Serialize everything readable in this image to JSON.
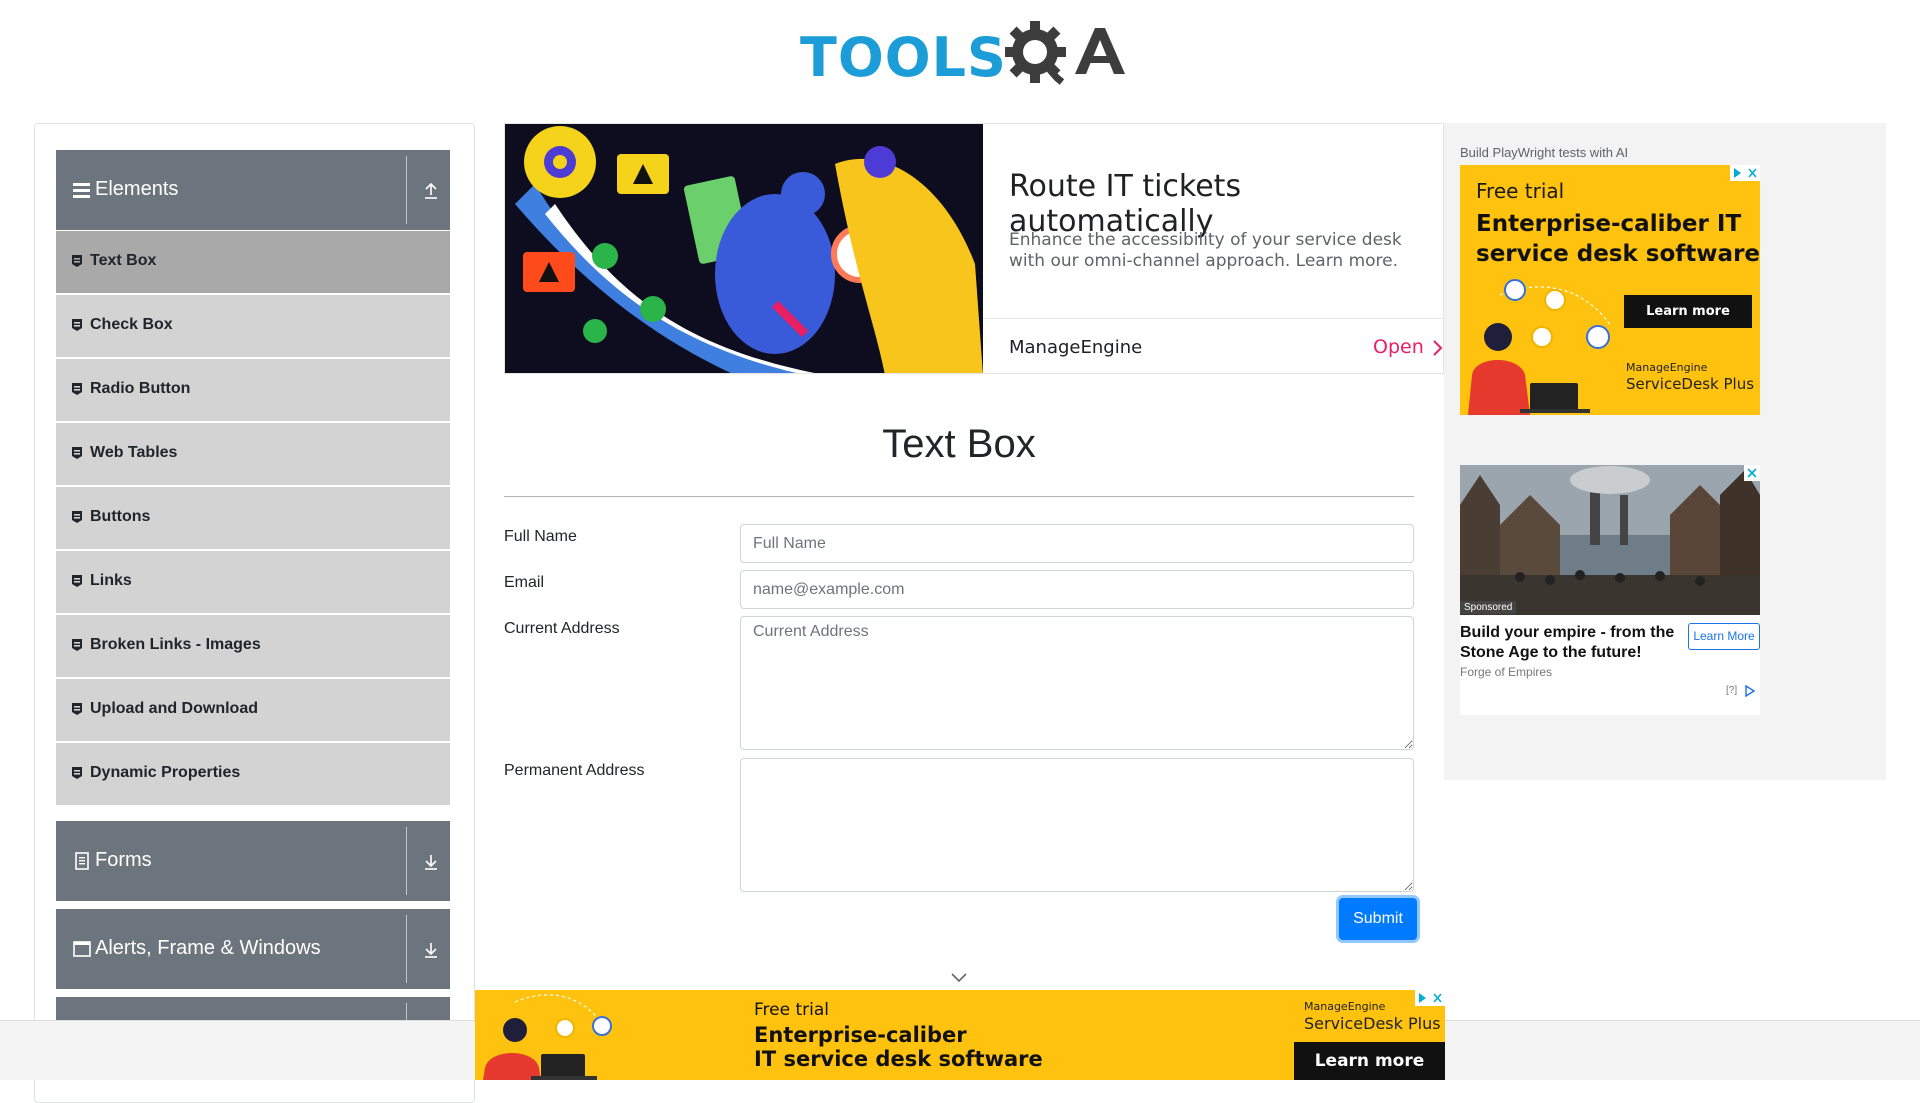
{
  "header": {
    "logo_text": "TOOLS",
    "logo_suffix": "QA"
  },
  "sidebar": {
    "groups": [
      {
        "label": "Elements",
        "icon": "hamburger-icon",
        "state": "expanded"
      },
      {
        "label": "Forms",
        "icon": "document-icon",
        "state": "collapsed"
      },
      {
        "label": "Alerts, Frame & Windows",
        "icon": "window-icon",
        "state": "collapsed"
      }
    ],
    "items": [
      {
        "label": "Text Box",
        "active": true
      },
      {
        "label": "Check Box"
      },
      {
        "label": "Radio Button"
      },
      {
        "label": "Web Tables"
      },
      {
        "label": "Buttons"
      },
      {
        "label": "Links"
      },
      {
        "label": "Broken Links - Images"
      },
      {
        "label": "Upload and Download"
      },
      {
        "label": "Dynamic Properties"
      }
    ]
  },
  "banner": {
    "title": "Route IT tickets automatically",
    "description": "Enhance the accessibility of your service desk with our omni-channel approach. Learn more.",
    "brand": "ManageEngine",
    "cta": "Open"
  },
  "main": {
    "title": "Text Box",
    "fields": {
      "full_name": {
        "label": "Full Name",
        "placeholder": "Full Name",
        "value": ""
      },
      "email": {
        "label": "Email",
        "placeholder": "name@example.com",
        "value": ""
      },
      "current_address": {
        "label": "Current Address",
        "placeholder": "Current Address",
        "value": ""
      },
      "permanent_address": {
        "label": "Permanent Address",
        "placeholder": "",
        "value": ""
      }
    },
    "submit_label": "Submit"
  },
  "right_ads": {
    "caption": "Build PlayWright tests with AI",
    "ad1": {
      "free_trial": "Free trial",
      "headline": "Enterprise-caliber IT service desk software",
      "cta": "Learn more",
      "logo_top": "ManageEngine",
      "logo_bottom": "ServiceDesk Plus"
    },
    "ad2": {
      "sponsored": "Sponsored",
      "title": "Build your empire - from the Stone Age to the future!",
      "cta": "Learn More",
      "source": "Forge of Empires",
      "footer": "[?]"
    }
  },
  "bottom_ad": {
    "free_trial": "Free trial",
    "headline_1": "Enterprise-caliber",
    "headline_2": "IT service desk software",
    "logo_top": "ManageEngine",
    "logo_bottom": "ServiceDesk Plus",
    "cta": "Learn more"
  },
  "colors": {
    "brand_blue": "#1d9dd7",
    "sidebar_header": "#6c757d",
    "menu_item": "#d3d3d3",
    "menu_item_active": "#a9a9a9",
    "primary": "#007bff",
    "ad_yellow": "#ffc20e",
    "open_pink": "#e91e63"
  }
}
